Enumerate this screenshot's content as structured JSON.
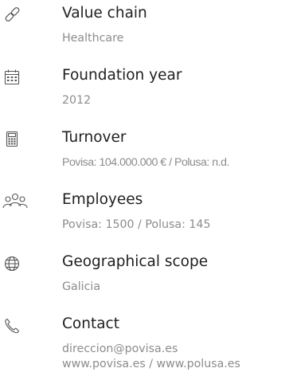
{
  "items": [
    {
      "icon": "link-icon",
      "label": "Value chain",
      "value": "Healthcare"
    },
    {
      "icon": "calendar-icon",
      "label": "Foundation year",
      "value": "2012"
    },
    {
      "icon": "calculator-icon",
      "label": "Turnover",
      "value": "Povisa: 104.000.000 € / Polusa: n.d."
    },
    {
      "icon": "people-icon",
      "label": "Employees",
      "value": "Povisa: 1500 / Polusa: 145"
    },
    {
      "icon": "globe-icon",
      "label": "Geographical scope",
      "value": "Galicia"
    },
    {
      "icon": "phone-icon",
      "label": "Contact",
      "value_lines": [
        "direccion@povisa.es",
        "www.povisa.es / www.polusa.es"
      ]
    }
  ],
  "colors": {
    "label": "#1f1f1f",
    "value": "#8c8c8c",
    "icon": "#555555"
  }
}
